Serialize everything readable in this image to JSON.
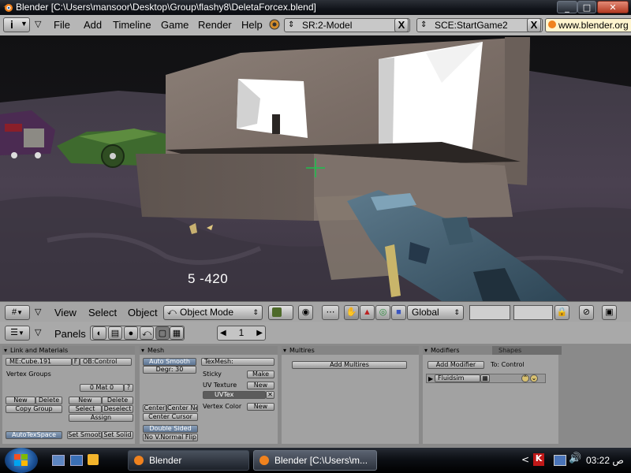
{
  "window": {
    "title": "Blender [C:\\Users\\mansoor\\Desktop\\Group\\flashy8\\DeletaForcex.blend]",
    "controls": {
      "minimize": "_",
      "maximize": "□",
      "close": "✕"
    }
  },
  "menubar": {
    "info_icon": "i",
    "items": [
      "File",
      "Add",
      "Timeline",
      "Game",
      "Render",
      "Help"
    ],
    "screen_field": "SR:2-Model",
    "scene_field": "SCE:StartGame2",
    "url_text": "www.blender.org",
    "close_glyph": "X"
  },
  "viewport": {
    "hud_text": "5  -420"
  },
  "view3d_header": {
    "menus": [
      "View",
      "Select",
      "Object"
    ],
    "mode": "Object Mode",
    "orientation": "Global"
  },
  "buttons_header": {
    "panels_label": "Panels",
    "frame_value": "1"
  },
  "panels": {
    "link_materials": {
      "title": "Link and Materials",
      "me_field": "ME:Cube.191",
      "f_label": "F",
      "ob_field": "OB:Control",
      "vertex_groups": "Vertex Groups",
      "mat_field": "0 Mat 0",
      "question": "?",
      "new1": "New",
      "delete1": "Delete",
      "copy_group": "Copy Group",
      "new2": "New",
      "delete2": "Delete",
      "select": "Select",
      "deselect": "Deselect",
      "assign": "Assign",
      "autotexspace": "AutoTexSpace",
      "set_smooth": "Set Smoot",
      "set_solid": "Set Solid"
    },
    "mesh": {
      "title": "Mesh",
      "auto_smooth": "Auto Smooth",
      "degr": "Degr: 30",
      "texmesh": "TexMesh:",
      "sticky": "Sticky",
      "make": "Make",
      "uv_texture": "UV Texture",
      "new": "New",
      "uvtex": "UVTex",
      "vertex_color": "Vertex Color",
      "new2": "New",
      "center": "Center",
      "center_new": "Center Ne",
      "center_cursor": "Center Cursor",
      "double_sided": "Double Sided",
      "no_vnormal_flip": "No V.Normal Flip"
    },
    "multires": {
      "title": "Multires",
      "add_multires": "Add Multires"
    },
    "modifiers": {
      "tab_modifiers": "Modifiers",
      "tab_shapes": "Shapes",
      "add_modifier": "Add Modifier",
      "to_label": "To: Control",
      "fluidsim": "Fluidsim"
    }
  },
  "taskbar": {
    "tasks": [
      {
        "label": "Blender"
      },
      {
        "label": "Blender [C:\\Users\\m..."
      }
    ],
    "clock": "03:22 ص"
  },
  "colors": {
    "titlebar": "#11141a",
    "menubar": "#b6b6b6",
    "panel_bg": "#a2a2a2",
    "buttons_bg": "#8a8a8a",
    "crosshair": "#1dbf4d"
  }
}
